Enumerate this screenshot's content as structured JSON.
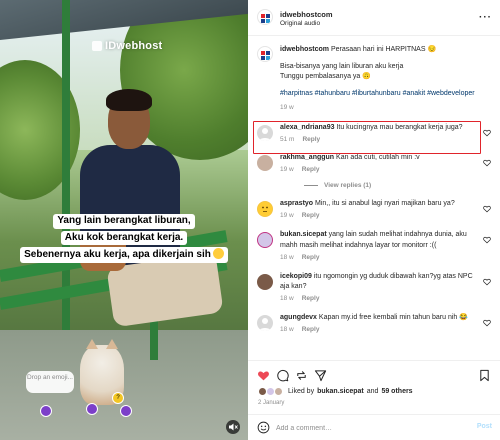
{
  "media": {
    "watermark": "IDwebhost",
    "caption_lines": [
      "Yang lain berangkat liburan,",
      "Aku kok berangkat kerja.",
      "Sebenernya aku kerja, apa dikerjain sih"
    ],
    "drop_emoji": "Drop an emoji...",
    "sticker_question": "?"
  },
  "header": {
    "username": "idwebhostcom",
    "audio": "Original audio",
    "more": "···"
  },
  "post": {
    "username": "idwebhostcom",
    "text1": "Perasaan hari ini HARPITNAS 😔",
    "text2": "Bisa-bisanya yang lain liburan aku kerja",
    "text3": "Tunggu pembalasanya ya 🙃",
    "hashtags": "#harpitnas #tahunbaru #liburtahunbaru #anakit #webdeveloper",
    "time": "19 w"
  },
  "comments": [
    {
      "username": "alexa_ndriana93",
      "text": "Itu kucingnya mau berangkat kerja juga?",
      "time": "51 m",
      "reply": "Reply"
    },
    {
      "username": "rakhma_anggun",
      "text": "Kan ada cuti, cutilah min :v",
      "time": "19 w",
      "reply": "Reply",
      "view_replies": "View replies (1)"
    },
    {
      "username": "asprastyo",
      "text": "Min,, itu si anabul lagi nyari majikan baru ya?",
      "time": "19 w",
      "reply": "Reply"
    },
    {
      "username": "bukan.sicepat",
      "text": "yang lain sudah melihat indahnya dunia, aku mahh masih melihat indahnya layar tor monitorr :((",
      "time": "18 w",
      "reply": "Reply"
    },
    {
      "username": "icekopi09",
      "text": "itu ngomongin yg duduk dibawah kan?yg atas NPC aja kan?",
      "time": "18 w",
      "reply": "Reply"
    },
    {
      "username": "agungdevx",
      "text": "Kapan my.id free kembali min tahun baru nih 😂",
      "time": "18 w",
      "reply": "Reply"
    }
  ],
  "likes": {
    "prefix": "Liked by ",
    "user": "bukan.sicepat",
    "and": " and ",
    "count": "59 others"
  },
  "date": "2 January",
  "add_comment": {
    "placeholder": "Add a comment…",
    "post_label": "Post"
  },
  "colors": {
    "highlight": "#e0242b",
    "link": "#00376b",
    "muted": "#8e8e8e",
    "post_disabled": "#b2dffc"
  }
}
